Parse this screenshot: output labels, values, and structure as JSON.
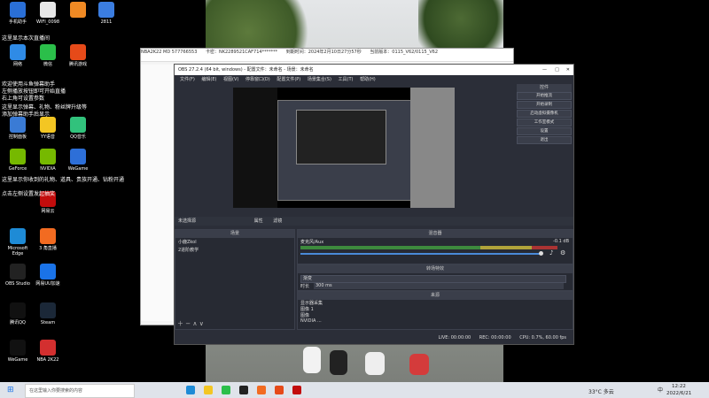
{
  "desktop": {
    "icons": [
      {
        "label": "手机助手",
        "color": "#2a6fd6"
      },
      {
        "label": "WIFI_0098",
        "color": "#e7e7e7"
      },
      {
        "label": "",
        "color": "#f08a24"
      },
      {
        "label": "2811",
        "color": "#3b7de0"
      },
      {
        "label": "网络",
        "color": "#2f8be6"
      },
      {
        "label": "微信",
        "color": "#2bbf4a"
      },
      {
        "label": "腾讯游戏",
        "color": "#e64a19"
      },
      {
        "label": "控制面板",
        "color": "#3a7bd5"
      },
      {
        "label": "YY语音",
        "color": "#f3c623"
      },
      {
        "label": "QQ音乐",
        "color": "#31c27c"
      },
      {
        "label": "GeForce",
        "color": "#76b900"
      },
      {
        "label": "NVIDIA",
        "color": "#76b900"
      },
      {
        "label": "WeGame",
        "color": "#2d6fd8"
      },
      {
        "label": "网易云",
        "color": "#c20c0c"
      },
      {
        "label": "Microsoft Edge",
        "color": "#1e8bd6"
      },
      {
        "label": "3 角直播",
        "color": "#f26b21"
      },
      {
        "label": "OBS Studio",
        "color": "#222222"
      },
      {
        "label": "网易UU加速",
        "color": "#1a73e8"
      },
      {
        "label": "腾讯QQ",
        "color": "#111111"
      },
      {
        "label": "Steam",
        "color": "#1b2838"
      },
      {
        "label": "WeGame",
        "color": "#111111"
      },
      {
        "label": "NBA 2K22",
        "color": "#d32f2f"
      }
    ],
    "notes": [
      "这里显示本次直播间",
      "欢迎使用斗鱼弹幕助手",
      "左侧播放按钮即可开始直播",
      "右上角可设置参数",
      "这里显示弹幕、礼物、粉丝牌升级等",
      "添加弹幕助手后显示",
      "这里显示你收到的礼物、道具、贵族开通、钻粉开通",
      "点击左侧设置发起抽奖"
    ]
  },
  "nba_window": {
    "title": "NBA2K22 MD 577766553",
    "card": "卡密：NK2289521CAF714*******",
    "expire": "到期时间：2024年2月10日27分57秒",
    "version": "当前版本：0115_V62/0115_V62"
  },
  "obs": {
    "title": "OBS 27.2.4 (64 bit, windows) - 配置文件：未命名 - 场景：未命名",
    "menu": [
      "文件(F)",
      "编辑(E)",
      "视图(V)",
      "停靠窗口(D)",
      "配置文件(P)",
      "场景集合(S)",
      "工具(T)",
      "帮助(H)"
    ],
    "source_toolbar": [
      "未选择源",
      "属性",
      "滤镜"
    ],
    "controls_header": "控件",
    "controls": [
      "开始推流",
      "开始录制",
      "启动虚拟摄像机",
      "工作室模式",
      "设置",
      "退出"
    ],
    "scenes_header": "场景",
    "scenes": [
      "小鹿Zkol",
      "2进阶教学"
    ],
    "mixer_header": "混音器",
    "mixer_track": "麦克风/Aux",
    "mixer_db": "-0.1 dB",
    "transitions_header": "转场特效",
    "transition_name": "渐变",
    "duration_label": "时长",
    "duration_value": "300 ms",
    "sources_header": "来源",
    "sources": [
      "显示器采集",
      "图像 1",
      "图像",
      "NVIDIA ..."
    ],
    "status": {
      "live": "LIVE: 00:00:00",
      "rec": "REC: 00:00:00",
      "cpu": "CPU: 0.7%, 60.00 fps"
    }
  },
  "taskbar": {
    "search_placeholder": "在这里输入你要搜索的内容",
    "temp": "33°C 多云",
    "time": "12:22",
    "date": "2022/6/21",
    "lang": "中"
  }
}
